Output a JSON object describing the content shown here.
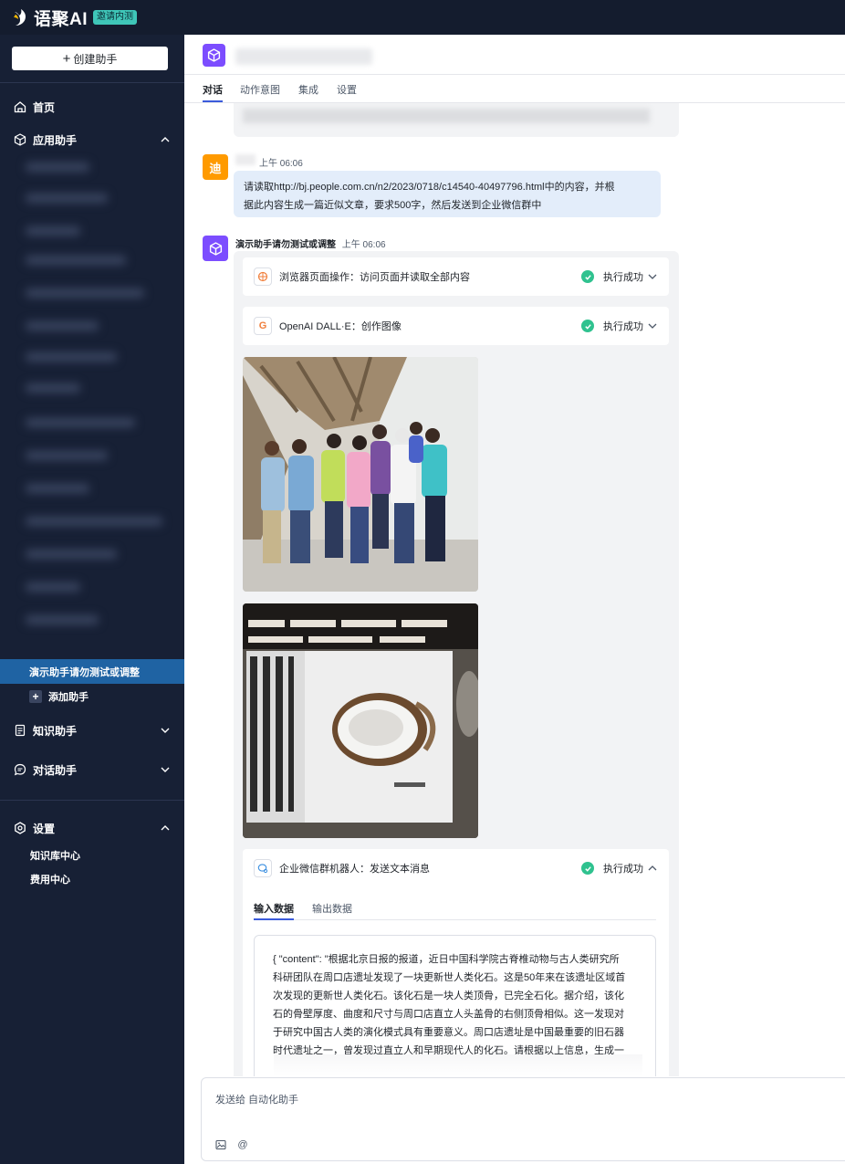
{
  "app": {
    "name": "语聚AI",
    "badge": "邀请内测"
  },
  "sidebar": {
    "create_button": "创建助手",
    "home": "首页",
    "app_assistants": "应用助手",
    "active_assistant": "演示助手请勿测试或调整",
    "add_assistant": "添加助手",
    "knowledge_assistants": "知识助手",
    "dialog_assistants": "对话助手",
    "settings": "设置",
    "settings_items": [
      "知识库中心",
      "费用中心"
    ]
  },
  "header": {
    "tabs": [
      "对话",
      "动作意图",
      "集成",
      "设置"
    ],
    "active_tab": "对话"
  },
  "chat": {
    "user_message": {
      "avatar_text": "迪",
      "time": "上午 06:06",
      "text_line1": "请读取http://bj.people.com.cn/n2/2023/0718/c14540-40497796.html中的内容，并根",
      "text_line2": "据此内容生成一篇近似文章，要求500字，然后发送到企业微信群中"
    },
    "bot_message": {
      "name": "演示助手请勿测试或调整",
      "time": "上午 06:06",
      "tools": [
        {
          "icon": "browser-icon",
          "name": "浏览器页面操作：访问页面并读取全部内容",
          "status": "执行成功"
        },
        {
          "icon": "openai-icon",
          "icon_letter": "G",
          "name": "OpenAI DALL·E：创作图像",
          "status": "执行成功"
        }
      ],
      "wecom_tool": {
        "icon": "wecom-icon",
        "name": "企业微信群机器人：发送文本消息",
        "status": "执行成功",
        "tabs": [
          "输入数据",
          "输出数据"
        ],
        "active_tab": "输入数据",
        "json_lines": [
          "{ \"content\": \"根据北京日报的报道，近日中国科学院古脊椎动物与古人类研究所",
          "科研团队在周口店遗址发现了一块更新世人类化石。这是50年来在该遗址区域首",
          "次发现的更新世人类化石。该化石是一块人类顶骨，已完全石化。据介绍，该化",
          "石的骨壁厚度、曲度和尺寸与周口店直立人头盖骨的右侧顶骨相似。这一发现对",
          "于研究中国古人类的演化模式具有重要意义。周口店遗址是中国最重要的旧石器",
          "时代遗址之一，曾发现过直立人和早期现代人的化石。请根据以上信息，生成一"
        ]
      }
    }
  },
  "composer": {
    "placeholder": "发送给 自动化助手"
  },
  "colors": {
    "sidebar_bg": "#172035",
    "topbar_bg": "#141c2e",
    "active_item": "#1f63a3",
    "bot_avatar": "#7c4dff",
    "user_avatar": "#ff9a00",
    "success": "#2fc28f",
    "user_bubble": "#e3edfa"
  }
}
